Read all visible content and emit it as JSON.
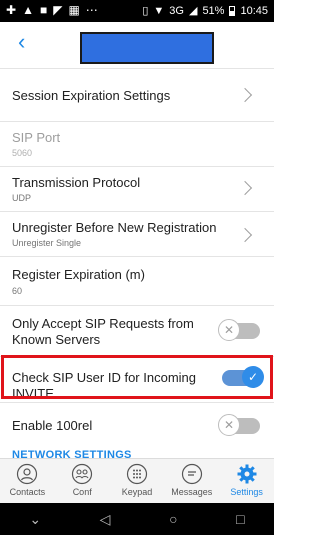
{
  "status_bar": {
    "left_icons": [
      "4g-plus-icon",
      "warning-icon",
      "gallery-icon",
      "wifi-icon",
      "app-icon",
      "more-icon"
    ],
    "signal": "3G",
    "battery": "51%",
    "time": "10:45"
  },
  "header": {
    "back_icon": "chevron-left-icon",
    "title": ""
  },
  "settings": {
    "session_expiration": "Session Expiration Settings",
    "sip_port_label": "SIP Port",
    "sip_port_value": "5060",
    "transmission_protocol_label": "Transmission Protocol",
    "transmission_protocol_value": "UDP",
    "unregister_label": "Unregister Before New Registration",
    "unregister_value": "Unregister Single",
    "register_expiration_label": "Register Expiration (m)",
    "register_expiration_value": "60",
    "only_accept_label": "Only Accept SIP Requests from Known Servers",
    "only_accept_state": "off",
    "check_sip_label": "Check SIP User ID for Incoming INVITE",
    "check_sip_state": "on",
    "enable_100rel_label": "Enable 100rel",
    "enable_100rel_state": "off",
    "network_section": "NETWORK SETTINGS"
  },
  "tabs": [
    {
      "label": "Contacts",
      "icon": "contacts-icon",
      "active": false
    },
    {
      "label": "Conf",
      "icon": "conference-icon",
      "active": false
    },
    {
      "label": "Keypad",
      "icon": "keypad-icon",
      "active": false
    },
    {
      "label": "Messages",
      "icon": "messages-icon",
      "active": false
    },
    {
      "label": "Settings",
      "icon": "settings-gear-icon",
      "active": true
    }
  ],
  "colors": {
    "accent": "#1e88e5",
    "highlight": "#e0141a",
    "toggle_on": "#2f8ce8"
  }
}
